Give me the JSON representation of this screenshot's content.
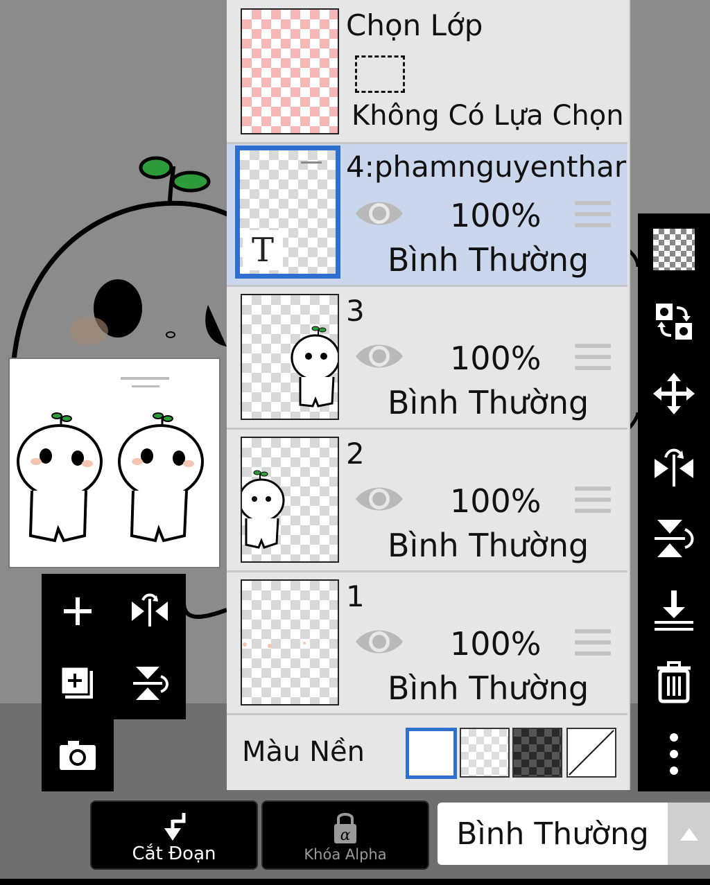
{
  "selection_layer": {
    "title": "Chọn Lớp",
    "status": "Không Có Lựa Chọn"
  },
  "layers": [
    {
      "name": "4:phamnguyenthar",
      "opacity": "100%",
      "mode": "Bình Thường",
      "selected": true,
      "type_badge": "T"
    },
    {
      "name": "3",
      "opacity": "100%",
      "mode": "Bình Thường",
      "selected": false
    },
    {
      "name": "2",
      "opacity": "100%",
      "mode": "Bình Thường",
      "selected": false
    },
    {
      "name": "1",
      "opacity": "100%",
      "mode": "Bình Thường",
      "selected": false
    }
  ],
  "background": {
    "label": "Màu Nền",
    "options": [
      "white",
      "transparent",
      "dark-checker",
      "none"
    ],
    "selected": "white"
  },
  "bottom_bar": {
    "clip_label": "Cắt Đoạn",
    "alpha_lock_label": "Khóa Alpha",
    "alpha_symbol": "α",
    "blend_mode": "Bình Thường"
  },
  "right_toolbar": {
    "icons": [
      "transparency-icon",
      "swap-layers-icon",
      "move-icon",
      "flip-horizontal-icon",
      "flip-vertical-icon",
      "merge-down-icon",
      "trash-icon",
      "more-icon"
    ]
  },
  "left_toolbar": {
    "icons": [
      "add-layer-icon",
      "flip-horizontal-icon",
      "add-layer-copy-icon",
      "flip-vertical-icon",
      "camera-icon"
    ]
  },
  "colors": {
    "accent": "#2f6fd0",
    "selected_row": "#c9d6ec",
    "panel": "#e6e6e6",
    "toolbar": "#000000"
  }
}
